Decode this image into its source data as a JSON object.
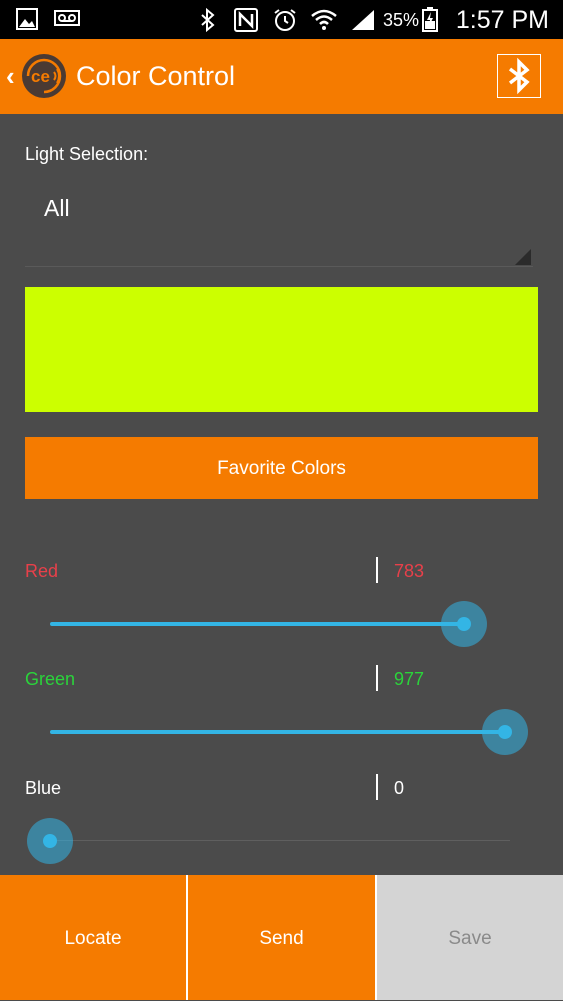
{
  "status_bar": {
    "battery_percent": "35%",
    "time": "1:57 PM",
    "icons": [
      "image-icon",
      "voicemail-icon",
      "bluetooth-icon",
      "nfc-icon",
      "alarm-icon",
      "wifi-icon",
      "signal-icon",
      "battery-icon"
    ]
  },
  "header": {
    "back_icon": "chevron-left-icon",
    "logo_text": "ce",
    "title": "Color Control",
    "bluetooth_icon": "bluetooth-icon"
  },
  "light_selection": {
    "label": "Light Selection:",
    "selected": "All"
  },
  "color_preview": {
    "color": "#ccff00"
  },
  "favorite_button": {
    "label": "Favorite Colors"
  },
  "channels": [
    {
      "label": "Red",
      "value": "783",
      "level": 0.9,
      "color": "#e8404a"
    },
    {
      "label": "Green",
      "value": "977",
      "level": 0.99,
      "color": "#2bd33b"
    },
    {
      "label": "Blue",
      "value": "0",
      "level": 0.0,
      "color": "#ffffff"
    }
  ],
  "bottom_buttons": {
    "locate": "Locate",
    "send": "Send",
    "save": "Save"
  },
  "colors": {
    "accent": "#f57b00",
    "background": "#4b4b4b",
    "slider": "#33b5e5",
    "disabled": "#d4d4d4"
  }
}
